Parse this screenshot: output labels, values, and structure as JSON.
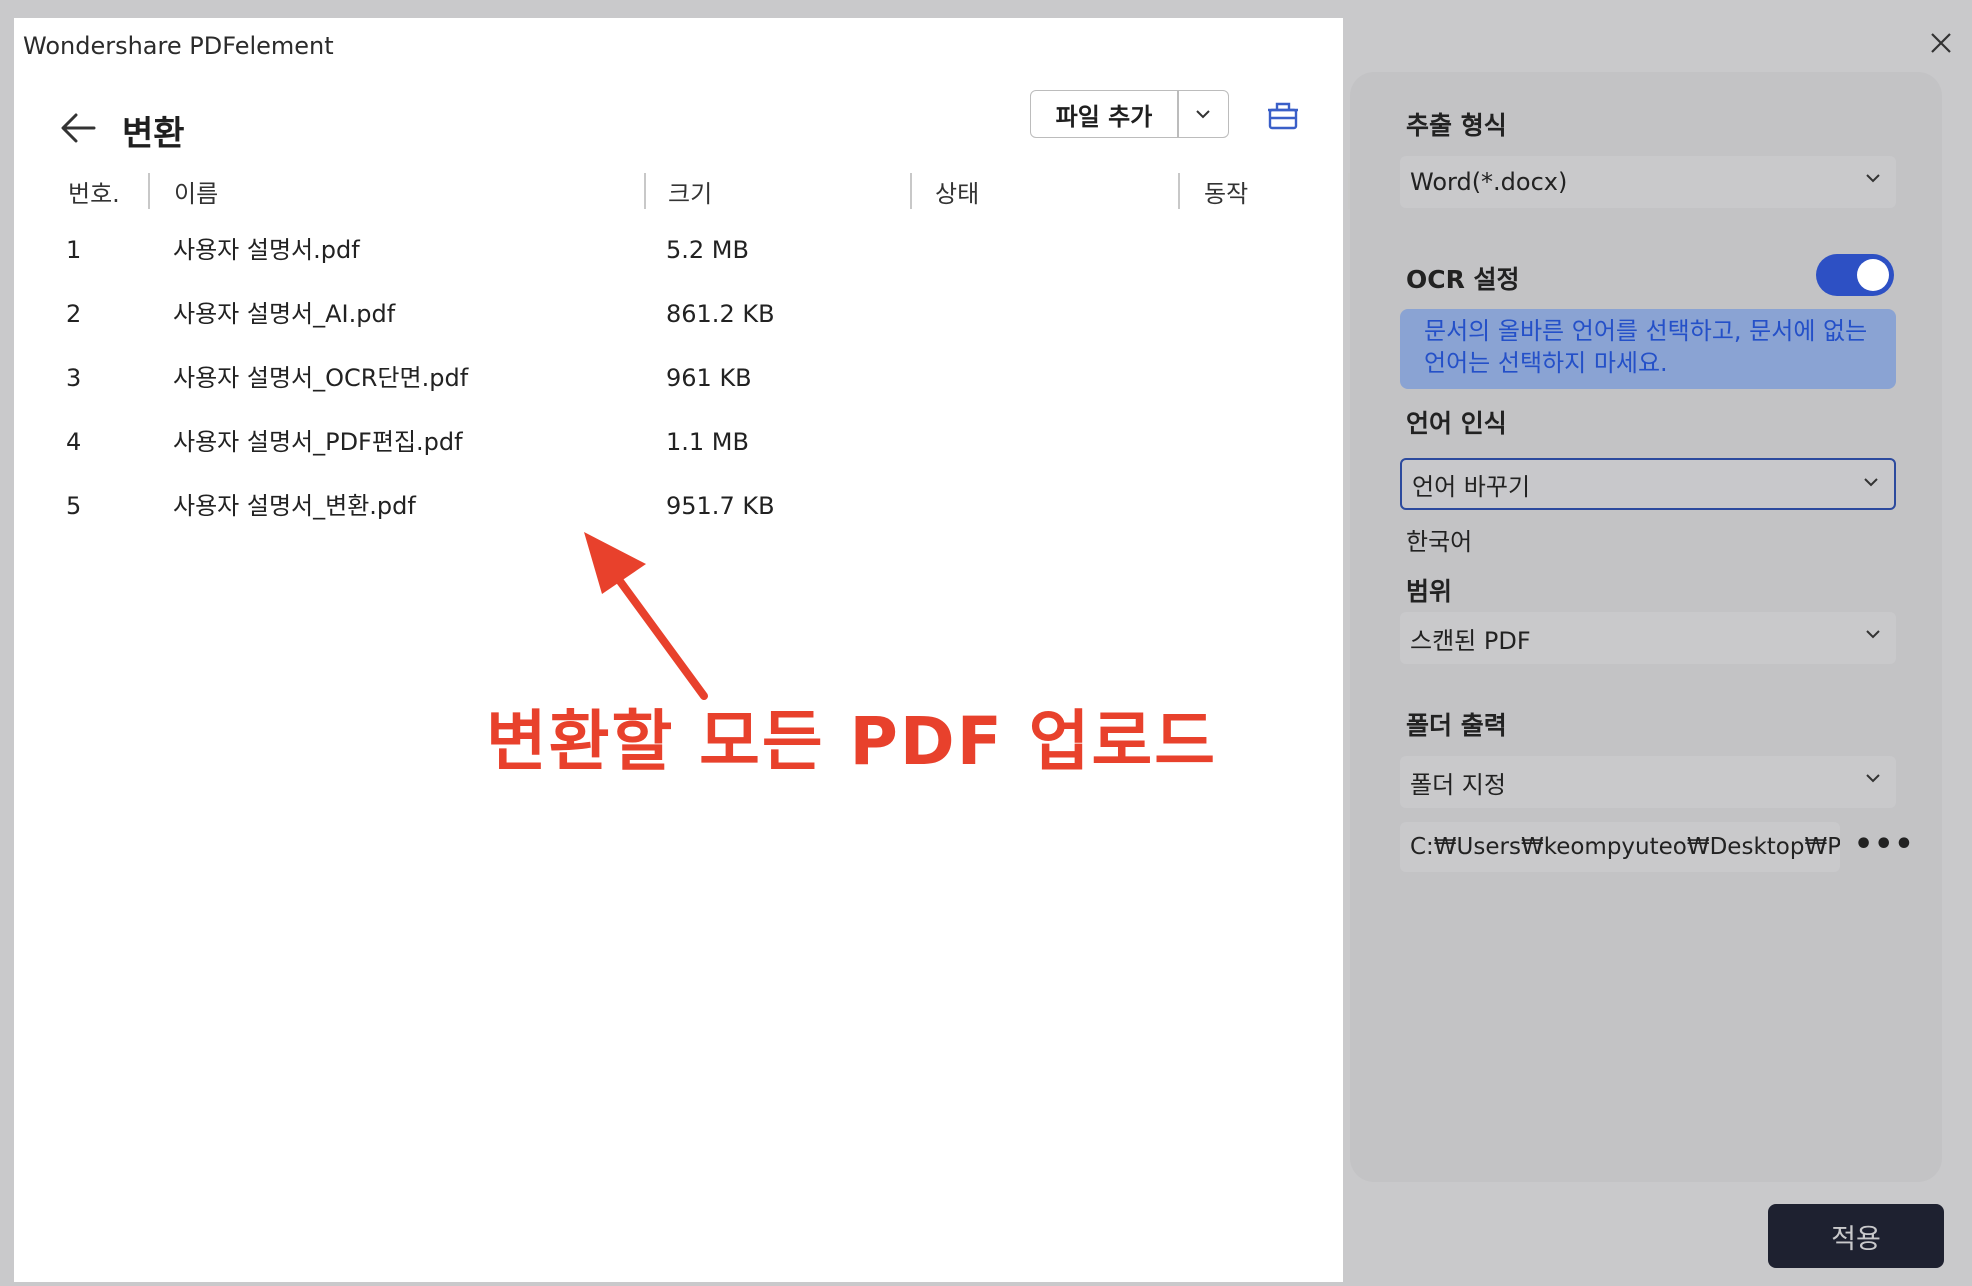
{
  "app": {
    "title": "Wondershare PDFelement"
  },
  "header": {
    "title": "변환",
    "add_file_label": "파일 추가"
  },
  "table": {
    "columns": [
      "번호.",
      "이름",
      "크기",
      "상태",
      "동작"
    ],
    "rows": [
      {
        "no": "1",
        "name": "사용자 설명서.pdf",
        "size": "5.2 MB"
      },
      {
        "no": "2",
        "name": "사용자 설명서_AI.pdf",
        "size": "861.2 KB"
      },
      {
        "no": "3",
        "name": "사용자 설명서_OCR단면.pdf",
        "size": "961 KB"
      },
      {
        "no": "4",
        "name": "사용자 설명서_PDF편집.pdf",
        "size": "1.1 MB"
      },
      {
        "no": "5",
        "name": "사용자 설명서_변환.pdf",
        "size": "951.7 KB"
      }
    ]
  },
  "annotation": {
    "text": "변환할 모든 PDF 업로드"
  },
  "settings": {
    "export_format_label": "추출 형식",
    "export_format_value": "Word(*.docx)",
    "ocr_label": "OCR 설정",
    "ocr_enabled": true,
    "ocr_info": "문서의 올바른 언어를 선택하고, 문서에 없는 언어는 선택하지 마세요.",
    "language_label": "언어 인식",
    "language_select": "언어 바꾸기",
    "language_value": "한국어",
    "range_label": "범위",
    "range_value": "스캔된 PDF",
    "output_folder_label": "폴더 출력",
    "output_folder_value": "폴더 지정",
    "output_path": "C:₩Users₩keompyuteo₩Desktop₩PDF",
    "more_label": "•••",
    "apply_label": "적용"
  },
  "colors": {
    "accent": "#2d50c4",
    "annotation": "#e8412c",
    "apply_bg": "#1e2130"
  }
}
